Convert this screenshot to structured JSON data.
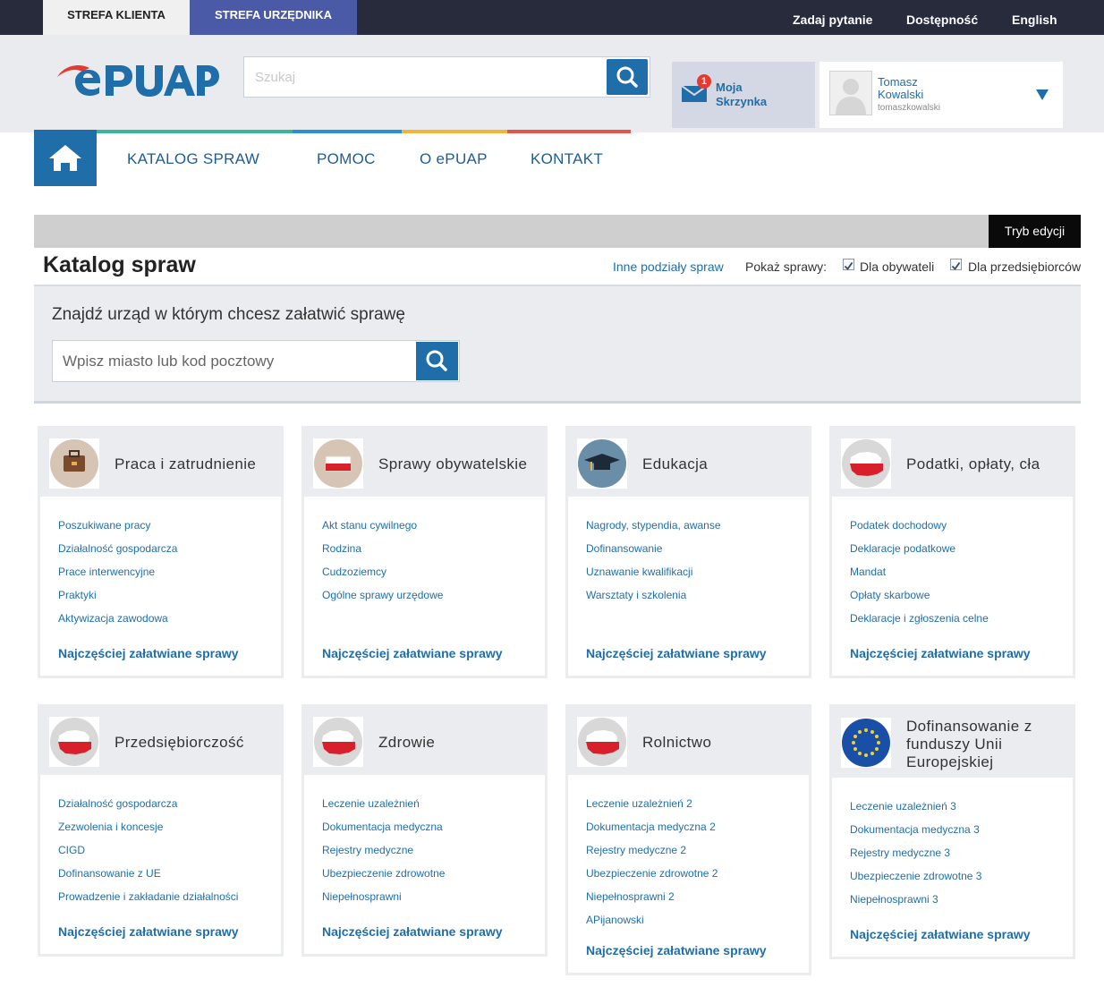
{
  "topbar": {
    "client_zone": "STREFA KLIENTA",
    "official_zone": "STREFA URZĘDNIKA",
    "links": [
      "Zadaj pytanie",
      "Dostępność",
      "English"
    ]
  },
  "header": {
    "search_placeholder": "Szukaj",
    "mailbox": {
      "count": "1",
      "line1": "Moja",
      "line2": "Skrzynka"
    },
    "user": {
      "first_name": "Tomasz",
      "last_name": "Kowalski",
      "login": "tomaszkowalski"
    }
  },
  "nav": [
    "KATALOG SPRAW",
    "POMOC",
    "O ePUAP",
    "KONTAKT"
  ],
  "catalog": {
    "edit_mode": "Tryb edycji",
    "title": "Katalog spraw",
    "other_divisions": "Inne podziały spraw",
    "show_label": "Pokaż sprawy:",
    "filter_citizens": "Dla obywateli",
    "filter_business": "Dla przedsiębiorców"
  },
  "finder": {
    "title": "Znajdź urząd w którym chcesz załatwić sprawę",
    "placeholder": "Wpisz miasto lub kod pocztowy"
  },
  "more_label": "Najczęściej załatwiane sprawy",
  "categories": [
    {
      "title": "Praca i zatrudnienie",
      "icon": "briefcase-icon",
      "links": [
        "Poszukiwane pracy",
        "Działalność gospodarcza",
        "Prace interwencyjne",
        "Praktyki",
        "Aktywizacja zawodowa"
      ]
    },
    {
      "title": "Sprawy obywatelskie",
      "icon": "polish-flag-icon",
      "links": [
        "Akt stanu cywilnego",
        "Rodzina",
        "Cudzoziemcy",
        "Ogólne sprawy urzędowe"
      ]
    },
    {
      "title": "Edukacja",
      "icon": "graduation-cap-icon",
      "links": [
        "Nagrody, stypendia, awanse",
        "Dofinansowanie",
        "Uznawanie kwalifikacji",
        "Warsztaty i szkolenia"
      ]
    },
    {
      "title": "Podatki, opłaty, cła",
      "icon": "poland-map-icon",
      "links": [
        "Podatek dochodowy",
        "Deklaracje podatkowe",
        "Mandat",
        "Opłaty skarbowe",
        "Deklaracje i zgłoszenia celne"
      ]
    },
    {
      "title": "Przedsiębiorczość",
      "icon": "poland-map-icon",
      "links": [
        "Działalność gospodarcza",
        "Zezwolenia i koncesje",
        "CIGD",
        "Dofinansowanie z UE",
        "Prowadzenie i zakładanie działalności"
      ]
    },
    {
      "title": "Zdrowie",
      "icon": "poland-map-icon",
      "links": [
        "Leczenie uzależnień",
        "Dokumentacja medyczna",
        "Rejestry medyczne",
        "Ubezpieczenie zdrowotne",
        "Niepełnosprawni"
      ]
    },
    {
      "title": "Rolnictwo",
      "icon": "poland-map-icon",
      "links": [
        "Leczenie uzależnień 2",
        "Dokumentacja medyczna 2",
        "Rejestry medyczne 2",
        "Ubezpieczenie zdrowotne 2",
        "Niepełnosprawni 2",
        "APijanowski"
      ]
    },
    {
      "title": "Dofinansowanie z funduszy Unii Europejskiej",
      "icon": "eu-flag-icon",
      "links": [
        "Leczenie uzależnień 3",
        "Dokumentacja medyczna 3",
        "Rejestry medyczne 3",
        "Ubezpieczenie zdrowotne 3",
        "Niepełnosprawni 3"
      ]
    }
  ]
}
